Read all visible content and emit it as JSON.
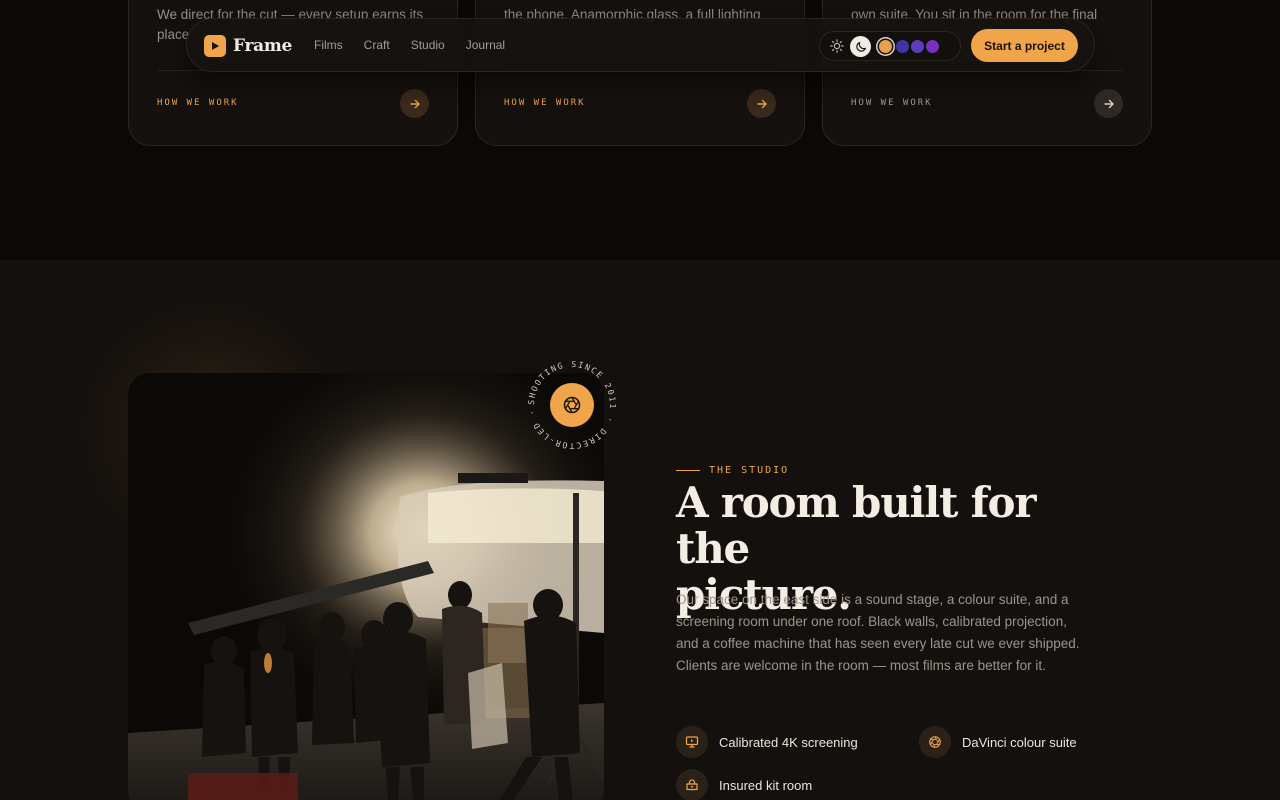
{
  "colors": {
    "accent": "#f0a54a",
    "background": "#0b0908",
    "section": "#14100d",
    "card": "#15110e"
  },
  "cards": [
    {
      "desc": "We direct for the cut — every setup earns its place",
      "link": "HOW WE WORK",
      "link_color": "#f0a54a",
      "arrow_icon": "arrow-right-icon",
      "arrow_bg": "#3a2b1c",
      "arrow_color": "#f0a54a"
    },
    {
      "desc": "the phone. Anamorphic glass, a full lighting",
      "link": "HOW WE WORK",
      "link_color": "#f0a54a",
      "arrow_icon": "arrow-right-icon",
      "arrow_bg": "#3a2b1c",
      "arrow_color": "#f0a54a"
    },
    {
      "desc": "own suite. You sit in the room for the final pass",
      "link": "HOW WE WORK",
      "link_color": "#a59c92",
      "arrow_icon": "arrow-right-icon",
      "arrow_bg": "#2e2925",
      "arrow_color": "#d9d2c8"
    }
  ],
  "nav": {
    "brand": "Frame",
    "links": [
      "Films",
      "Craft",
      "Studio",
      "Journal"
    ],
    "theme_icons": [
      "sun-icon",
      "moon-icon"
    ],
    "swatches": [
      {
        "name": "amber",
        "color": "#e9a04c",
        "selected": true
      },
      {
        "name": "indigo",
        "color": "#3b36a8",
        "selected": false
      },
      {
        "name": "violet",
        "color": "#5a3fb8",
        "selected": false
      },
      {
        "name": "purple",
        "color": "#7a2fc4",
        "selected": false
      }
    ],
    "cta": "Start a project"
  },
  "studio": {
    "badge_text": "SHOOTING SINCE 2011 · DIRECTOR-LED · ",
    "badge_icon": "aperture-icon",
    "eyebrow": "THE STUDIO",
    "headline_line1": "A room built for the",
    "headline_line2": "picture.",
    "body": "Our space on the east side is a sound stage, a colour suite, and a screening room under one roof. Black walls, calibrated projection, and a coffee machine that has seen every late cut we ever shipped. Clients are welcome in the room — most films are better for it.",
    "features": [
      {
        "label": "Calibrated 4K screening",
        "icon": "monitor-icon"
      },
      {
        "label": "DaVinci colour suite",
        "icon": "aperture-icon"
      },
      {
        "label": "Insured kit room",
        "icon": "box-icon"
      }
    ],
    "photo_alt": "Film crew on a dark stage around a lit set"
  }
}
